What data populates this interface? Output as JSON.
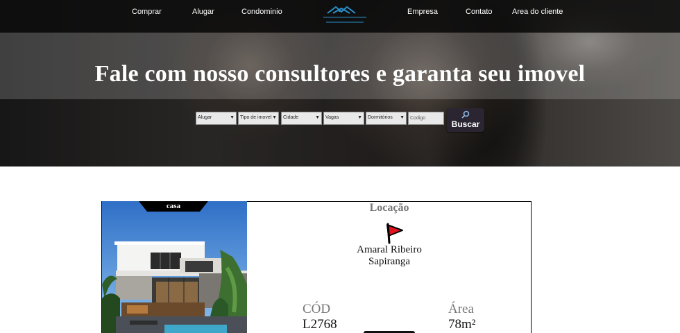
{
  "nav": {
    "items": [
      "Comprar",
      "Alugar",
      "Condominio",
      "Empresa",
      "Contato",
      "Area do cliente"
    ],
    "logo_icon": "house-roof-logo-icon"
  },
  "hero": {
    "headline": "Fale com nosso consultores e garanta seu imovel"
  },
  "search": {
    "selects": [
      "Alugar",
      "Tipo de imovel",
      "Cidade",
      "Vagas",
      "Dormitórios"
    ],
    "code_placeholder": "Codigo",
    "button_label": "Buscar",
    "button_icon": "search-icon"
  },
  "listing": {
    "type_tag": "casa",
    "location_title": "Locação",
    "location_icon": "red-flag-icon",
    "neighborhood": "Amaral Ribeiro",
    "city": "Sapiranga",
    "code_label": "CÓD",
    "code_value": "L2768",
    "area_label": "Área",
    "area_value": "78m²"
  },
  "colors": {
    "nav_bg": "#0c0c0c",
    "button_bg": "#2a2530",
    "flag_red": "#e0141f",
    "logo_blue": "#2a8fc9"
  }
}
